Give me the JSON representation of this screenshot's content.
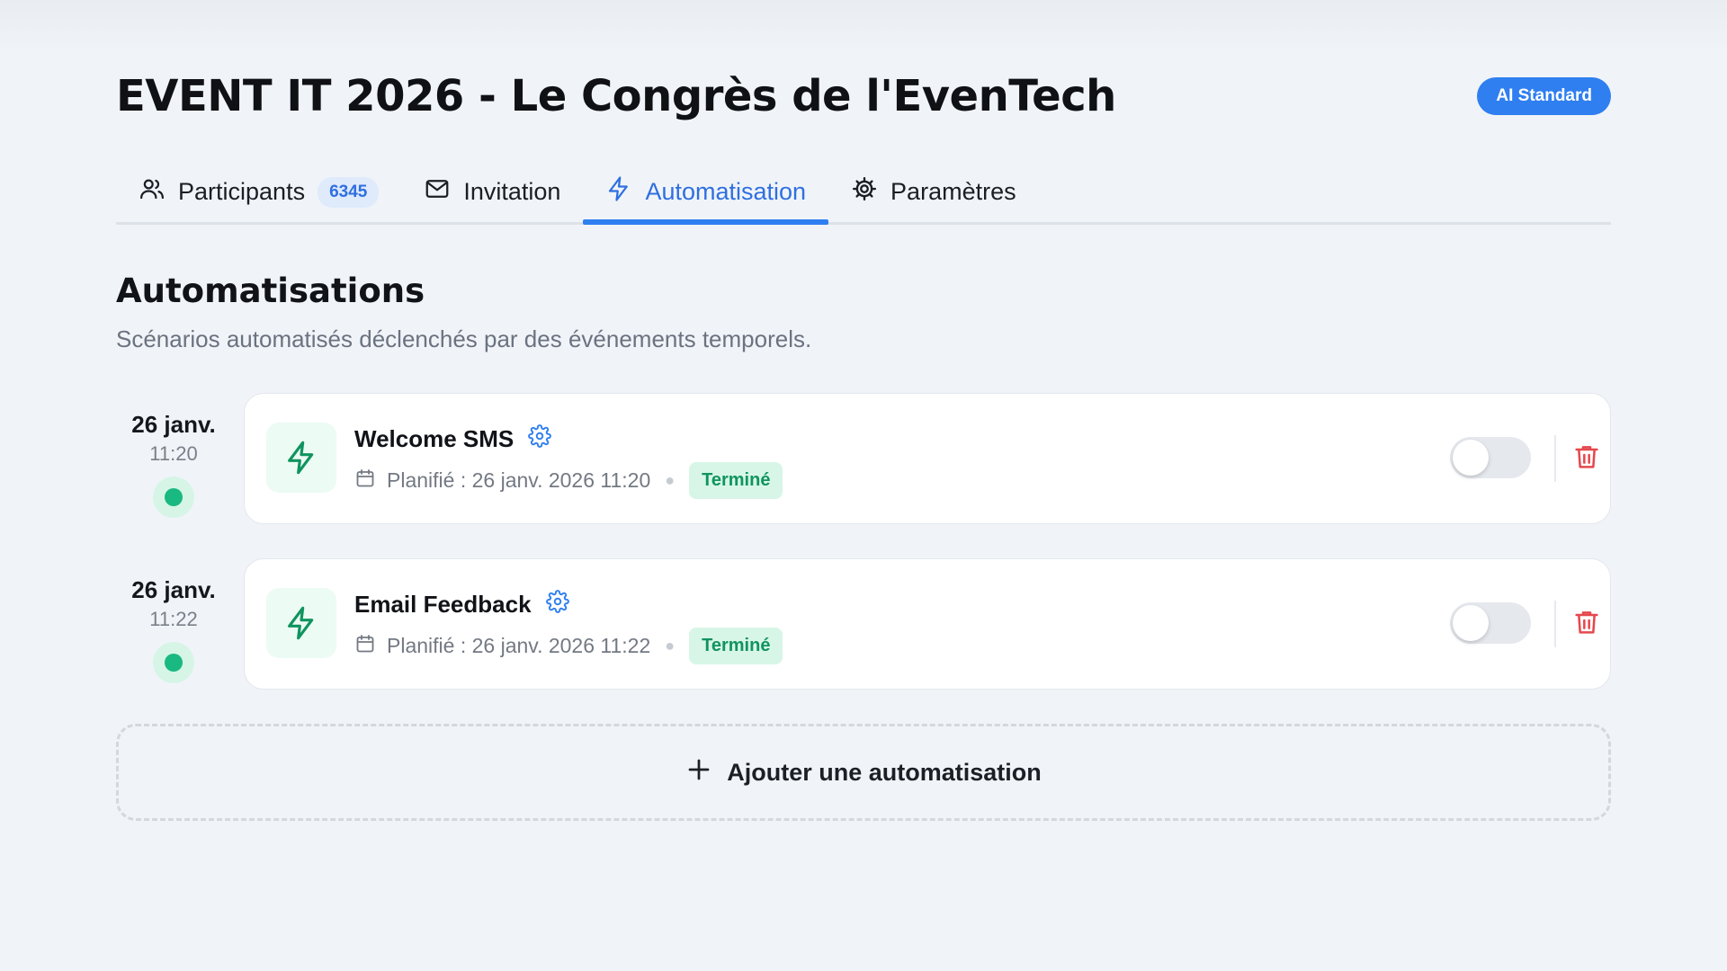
{
  "header": {
    "title": "EVENT IT 2026 - Le Congrès de l'EvenTech",
    "plan_badge": "AI Standard"
  },
  "tabs": [
    {
      "label": "Participants",
      "count": "6345",
      "icon": "users-icon",
      "active": false
    },
    {
      "label": "Invitation",
      "icon": "mail-icon",
      "active": false
    },
    {
      "label": "Automatisation",
      "icon": "zap-icon",
      "active": true
    },
    {
      "label": "Paramètres",
      "icon": "gear-icon",
      "active": false
    }
  ],
  "section": {
    "title": "Automatisations",
    "subtitle": "Scénarios automatisés déclenchés par des événements temporels."
  },
  "automations": [
    {
      "date": "26 janv.",
      "time": "11:20",
      "name": "Welcome SMS",
      "scheduled": "Planifié : 26 janv. 2026 11:20",
      "status": "Terminé",
      "enabled": false
    },
    {
      "date": "26 janv.",
      "time": "11:22",
      "name": "Email Feedback",
      "scheduled": "Planifié : 26 janv. 2026 11:22",
      "status": "Terminé",
      "enabled": false
    }
  ],
  "add_button": {
    "label": "Ajouter une automatisation"
  },
  "colors": {
    "accent": "#2f7ff0",
    "success": "#19b981",
    "danger": "#e5484d"
  }
}
